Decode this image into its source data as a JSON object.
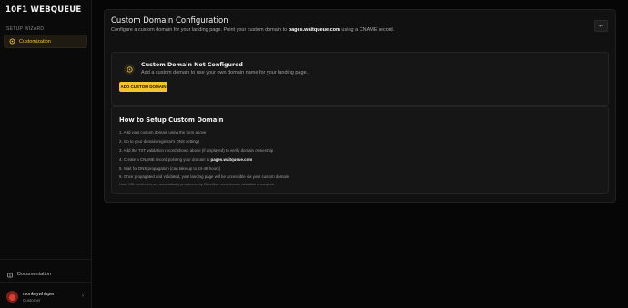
{
  "brand": {
    "name": "10F1 WEBQUEUE"
  },
  "sidebar": {
    "section_label": "SETUP WIZARD",
    "items": [
      {
        "label": "Customization",
        "icon": "gear-icon",
        "active": true
      }
    ],
    "documentation_label": "Documentation",
    "user": {
      "name": "monkeywhisper",
      "role": "Customer"
    }
  },
  "page": {
    "title": "Custom Domain Configuration",
    "subtitle_prefix": "Configure a custom domain for your landing page. Point your custom domain to ",
    "subtitle_domain": "pages.waitqueue.com",
    "subtitle_suffix": " using a CNAME record.",
    "back_icon": "arrow-left-icon"
  },
  "status": {
    "title": "Custom Domain Not Configured",
    "description": "Add a custom domain to use your own domain name for your landing page.",
    "button_label": "ADD CUSTOM DOMAIN"
  },
  "howto": {
    "title": "How to Setup Custom Domain",
    "steps": [
      "1. Add your custom domain using the form above",
      "2. Go to your domain registrar's DNS settings",
      "3. Add the TXT validation record shown above (if displayed) to verify domain ownership",
      "4. Create a CNAME record pointing your domain to ",
      "5. Wait for DNS propagation (can take up to 24-48 hours)",
      "6. Once propagated and validated, your landing page will be accessible via your custom domain"
    ],
    "step4_domain": "pages.waitqueue.com",
    "note": "Note: SSL certificates are automatically provisioned by Cloudflare once domain validation is complete."
  },
  "colors": {
    "accent": "#f4c430",
    "background": "#060606",
    "card": "#111111"
  }
}
